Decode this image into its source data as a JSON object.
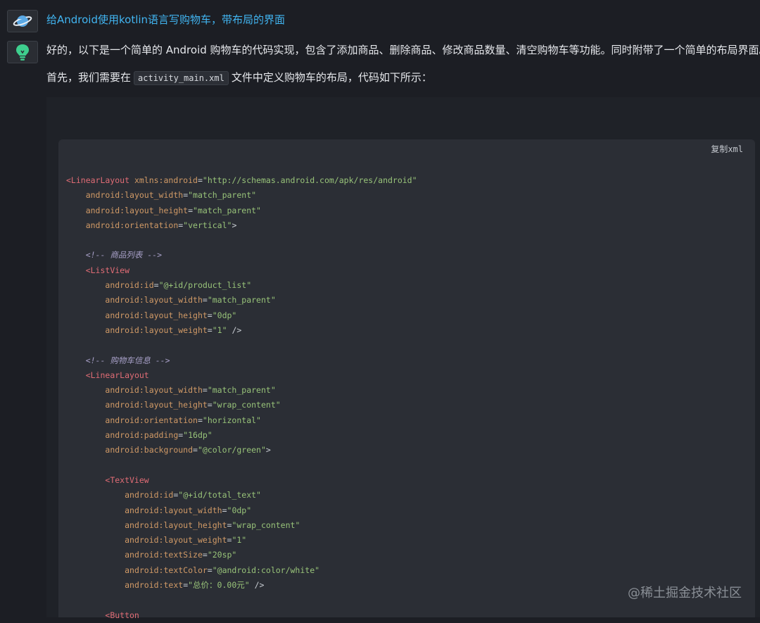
{
  "conversation": {
    "question": "给Android使用kotlin语言写购物车，带布局的界面",
    "answer_intro": "好的，以下是一个简单的 Android 购物车的代码实现，包含了添加商品、删除商品、修改商品数量、清空购物车等功能。同时附带了一个简单的布局界面。",
    "answer_before_code": "首先，我们需要在",
    "file_name": "activity_main.xml",
    "answer_after_code": "文件中定义购物车的布局，代码如下所示："
  },
  "code_block": {
    "copy_label": "复制",
    "language": "xml",
    "lines": [
      [
        [
          "tag",
          "<LinearLayout "
        ],
        [
          "attr",
          "xmlns:android"
        ],
        [
          "pun",
          "="
        ],
        [
          "str",
          "\"http://schemas.android.com/apk/res/android\""
        ]
      ],
      [
        [
          "pun",
          "    "
        ],
        [
          "attr",
          "android:layout_width"
        ],
        [
          "pun",
          "="
        ],
        [
          "str",
          "\"match_parent\""
        ]
      ],
      [
        [
          "pun",
          "    "
        ],
        [
          "attr",
          "android:layout_height"
        ],
        [
          "pun",
          "="
        ],
        [
          "str",
          "\"match_parent\""
        ]
      ],
      [
        [
          "pun",
          "    "
        ],
        [
          "attr",
          "android:orientation"
        ],
        [
          "pun",
          "="
        ],
        [
          "str",
          "\"vertical\""
        ],
        [
          "pun",
          ">"
        ]
      ],
      [],
      [
        [
          "pun",
          "    "
        ],
        [
          "com",
          "<!-- 商品列表 -->"
        ]
      ],
      [
        [
          "pun",
          "    "
        ],
        [
          "tag",
          "<ListView"
        ]
      ],
      [
        [
          "pun",
          "        "
        ],
        [
          "attr",
          "android:id"
        ],
        [
          "pun",
          "="
        ],
        [
          "str",
          "\"@+id/product_list\""
        ]
      ],
      [
        [
          "pun",
          "        "
        ],
        [
          "attr",
          "android:layout_width"
        ],
        [
          "pun",
          "="
        ],
        [
          "str",
          "\"match_parent\""
        ]
      ],
      [
        [
          "pun",
          "        "
        ],
        [
          "attr",
          "android:layout_height"
        ],
        [
          "pun",
          "="
        ],
        [
          "str",
          "\"0dp\""
        ]
      ],
      [
        [
          "pun",
          "        "
        ],
        [
          "attr",
          "android:layout_weight"
        ],
        [
          "pun",
          "="
        ],
        [
          "str",
          "\"1\""
        ],
        [
          "pun",
          " />"
        ]
      ],
      [],
      [
        [
          "pun",
          "    "
        ],
        [
          "com",
          "<!-- 购物车信息 -->"
        ]
      ],
      [
        [
          "pun",
          "    "
        ],
        [
          "tag",
          "<LinearLayout"
        ]
      ],
      [
        [
          "pun",
          "        "
        ],
        [
          "attr",
          "android:layout_width"
        ],
        [
          "pun",
          "="
        ],
        [
          "str",
          "\"match_parent\""
        ]
      ],
      [
        [
          "pun",
          "        "
        ],
        [
          "attr",
          "android:layout_height"
        ],
        [
          "pun",
          "="
        ],
        [
          "str",
          "\"wrap_content\""
        ]
      ],
      [
        [
          "pun",
          "        "
        ],
        [
          "attr",
          "android:orientation"
        ],
        [
          "pun",
          "="
        ],
        [
          "str",
          "\"horizontal\""
        ]
      ],
      [
        [
          "pun",
          "        "
        ],
        [
          "attr",
          "android:padding"
        ],
        [
          "pun",
          "="
        ],
        [
          "str",
          "\"16dp\""
        ]
      ],
      [
        [
          "pun",
          "        "
        ],
        [
          "attr",
          "android:background"
        ],
        [
          "pun",
          "="
        ],
        [
          "str",
          "\"@color/green\""
        ],
        [
          "pun",
          ">"
        ]
      ],
      [],
      [
        [
          "pun",
          "        "
        ],
        [
          "tag",
          "<TextView"
        ]
      ],
      [
        [
          "pun",
          "            "
        ],
        [
          "attr",
          "android:id"
        ],
        [
          "pun",
          "="
        ],
        [
          "str",
          "\"@+id/total_text\""
        ]
      ],
      [
        [
          "pun",
          "            "
        ],
        [
          "attr",
          "android:layout_width"
        ],
        [
          "pun",
          "="
        ],
        [
          "str",
          "\"0dp\""
        ]
      ],
      [
        [
          "pun",
          "            "
        ],
        [
          "attr",
          "android:layout_height"
        ],
        [
          "pun",
          "="
        ],
        [
          "str",
          "\"wrap_content\""
        ]
      ],
      [
        [
          "pun",
          "            "
        ],
        [
          "attr",
          "android:layout_weight"
        ],
        [
          "pun",
          "="
        ],
        [
          "str",
          "\"1\""
        ]
      ],
      [
        [
          "pun",
          "            "
        ],
        [
          "attr",
          "android:textSize"
        ],
        [
          "pun",
          "="
        ],
        [
          "str",
          "\"20sp\""
        ]
      ],
      [
        [
          "pun",
          "            "
        ],
        [
          "attr",
          "android:textColor"
        ],
        [
          "pun",
          "="
        ],
        [
          "str",
          "\"@android:color/white\""
        ]
      ],
      [
        [
          "pun",
          "            "
        ],
        [
          "attr",
          "android:text"
        ],
        [
          "pun",
          "="
        ],
        [
          "str",
          "\"总价：0.00元\""
        ],
        [
          "pun",
          " />"
        ]
      ],
      [],
      [
        [
          "pun",
          "        "
        ],
        [
          "tag",
          "<Button"
        ]
      ]
    ]
  },
  "watermark": "@稀土掘金技术社区",
  "icons": {
    "user_avatar": "planet-icon",
    "assistant_avatar": "lightbulb-icon"
  },
  "colors": {
    "question_text": "#41b4f0",
    "tag": "#e06c75",
    "attribute": "#d19a66",
    "string": "#98c379",
    "comment": "#a8a0c8"
  }
}
